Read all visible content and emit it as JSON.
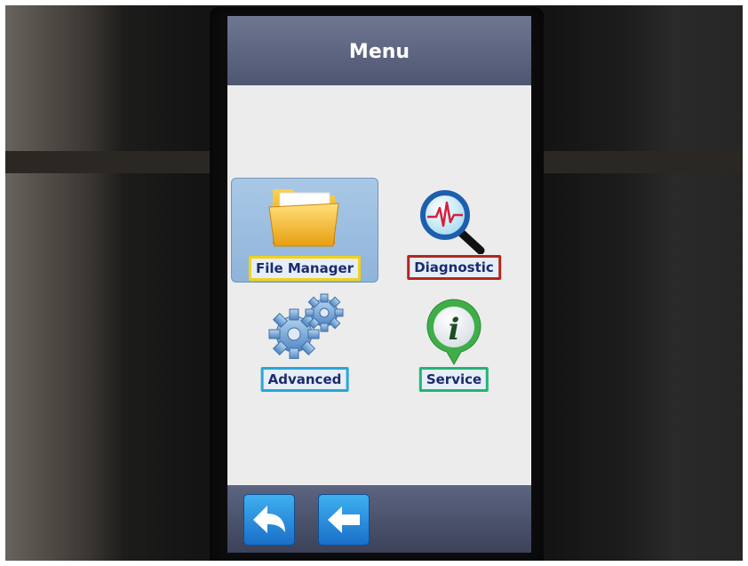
{
  "header": {
    "title": "Menu"
  },
  "menu": {
    "items": [
      {
        "label": "File Manager",
        "icon": "folder-icon",
        "highlight": "#f2d21a",
        "selected": true
      },
      {
        "label": "Diagnostic",
        "icon": "magnifier-waveform-icon",
        "highlight": "#b3261e",
        "selected": false
      },
      {
        "label": "Advanced",
        "icon": "gears-icon",
        "highlight": "#2aa6d8",
        "selected": false
      },
      {
        "label": "Service",
        "icon": "info-icon",
        "highlight": "#22b573",
        "selected": false
      }
    ]
  },
  "footer": {
    "buttons": [
      {
        "icon": "return-arrow-icon"
      },
      {
        "icon": "back-arrow-icon"
      }
    ]
  },
  "colors": {
    "header_bg": "#5a627d",
    "screen_bg": "#ececec",
    "nav_button": "#2a8ee0",
    "label_text": "#1c2b6e"
  }
}
